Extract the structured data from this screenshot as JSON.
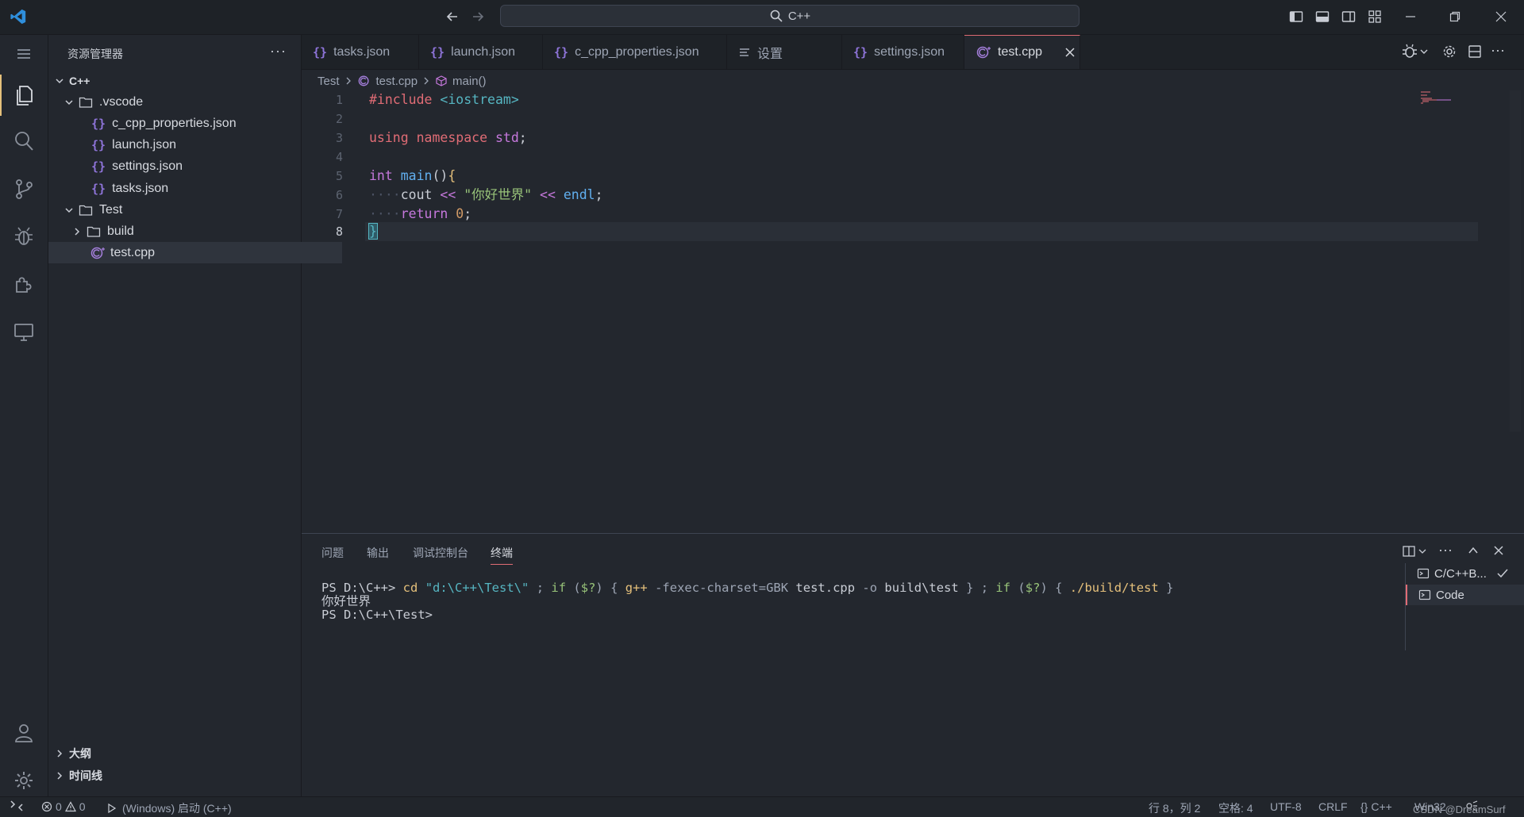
{
  "titlebar": {
    "search_text": "C++"
  },
  "sidebar": {
    "title": "资源管理器",
    "more": "···",
    "tree": [
      {
        "label": "C++"
      },
      {
        "label": ".vscode"
      },
      {
        "label": "c_cpp_properties.json"
      },
      {
        "label": "launch.json"
      },
      {
        "label": "settings.json"
      },
      {
        "label": "tasks.json"
      },
      {
        "label": "Test"
      },
      {
        "label": "build"
      },
      {
        "label": "test.cpp"
      }
    ],
    "outline": "大纲",
    "timeline": "时间线"
  },
  "tabs": [
    {
      "label": "tasks.json",
      "icon": "{}"
    },
    {
      "label": "launch.json",
      "icon": "{}"
    },
    {
      "label": "c_cpp_properties.json",
      "icon": "{}"
    },
    {
      "label": "设置",
      "icon": "≡"
    },
    {
      "label": "settings.json",
      "icon": "{}"
    },
    {
      "label": "test.cpp",
      "icon": "C++"
    }
  ],
  "breadcrumb": {
    "folder": "Test",
    "file": "test.cpp",
    "symbol": "main()"
  },
  "editor": {
    "line_numbers": [
      "1",
      "2",
      "3",
      "4",
      "5",
      "6",
      "7",
      "8"
    ],
    "current_line": "8"
  },
  "panel": {
    "tabs": [
      "问题",
      "输出",
      "调试控制台",
      "终端"
    ],
    "terminal": {
      "prompt1": "PS D:\\C++>",
      "output": "你好世界",
      "prompt2": "PS D:\\C++\\Test>"
    },
    "terminals": [
      "C/C++B...",
      "Code"
    ]
  },
  "statusbar": {
    "errors": "0",
    "warnings": "0",
    "launch": "(Windows) 启动 (C++)",
    "position": "行 8，列 2",
    "spaces": "空格: 4",
    "encoding": "UTF-8",
    "eol": "CRLF",
    "language": "C++",
    "platform": "Win32",
    "watermark": "CSDN @DreamSurf"
  },
  "colors": {
    "background": "#23272e",
    "accent": "#e06c75",
    "json_icon": "#8e74d9"
  }
}
